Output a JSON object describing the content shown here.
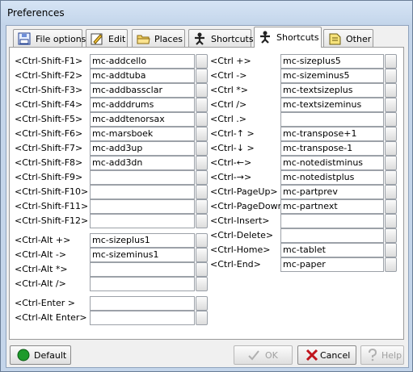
{
  "window": {
    "title": "Preferences"
  },
  "tabs": [
    {
      "label": "File options",
      "icon": "file-options-icon"
    },
    {
      "label": "Edit",
      "icon": "edit-icon"
    },
    {
      "label": "Places",
      "icon": "folder-icon"
    },
    {
      "label": "Shortcuts",
      "icon": "shortcuts-figure-icon"
    },
    {
      "label": "Shortcuts",
      "icon": "shortcuts-figure-icon",
      "active": true
    },
    {
      "label": "Other",
      "icon": "other-icon"
    }
  ],
  "left_shortcuts": [
    {
      "key": "<Ctrl-Shift-F1>",
      "value": "mc-addcello"
    },
    {
      "key": "<Ctrl-Shift-F2>",
      "value": "mc-addtuba"
    },
    {
      "key": "<Ctrl-Shift-F3>",
      "value": "mc-addbassclar"
    },
    {
      "key": "<Ctrl-Shift-F4>",
      "value": "mc-adddrums"
    },
    {
      "key": "<Ctrl-Shift-F5>",
      "value": "mc-addtenorsax"
    },
    {
      "key": "<Ctrl-Shift-F6>",
      "value": "mc-marsboek"
    },
    {
      "key": "<Ctrl-Shift-F7>",
      "value": "mc-add3up"
    },
    {
      "key": "<Ctrl-Shift-F8>",
      "value": "mc-add3dn"
    },
    {
      "key": "<Ctrl-Shift-F9>",
      "value": ""
    },
    {
      "key": "<Ctrl-Shift-F10>",
      "value": ""
    },
    {
      "key": "<Ctrl-Shift-F11>",
      "value": ""
    },
    {
      "key": "<Ctrl-Shift-F12>",
      "value": ""
    },
    {
      "key": "<Ctrl-Alt +>",
      "value": "mc-sizeplus1"
    },
    {
      "key": "<Ctrl-Alt ->",
      "value": "mc-sizeminus1"
    },
    {
      "key": "<Ctrl-Alt *>",
      "value": ""
    },
    {
      "key": "<Ctrl-Alt />",
      "value": ""
    },
    {
      "key": "<Ctrl-Enter >",
      "value": ""
    },
    {
      "key": "<Ctrl-Alt Enter>",
      "value": ""
    }
  ],
  "right_shortcuts": [
    {
      "key": "<Ctrl +>",
      "value": "mc-sizeplus5"
    },
    {
      "key": "<Ctrl ->",
      "value": "mc-sizeminus5"
    },
    {
      "key": "<Ctrl *>",
      "value": "mc-textsizeplus"
    },
    {
      "key": "<Ctrl />",
      "value": "mc-textsizeminus"
    },
    {
      "key": "<Ctrl .>",
      "value": ""
    },
    {
      "key": "<Ctrl-↑ >",
      "value": "mc-transpose+1"
    },
    {
      "key": "<Ctrl-↓ >",
      "value": "mc-transpose-1"
    },
    {
      "key": "<Ctrl-←>",
      "value": "mc-notedistminus"
    },
    {
      "key": "<Ctrl-→>",
      "value": "mc-notedistplus"
    },
    {
      "key": "<Ctrl-PageUp>",
      "value": "mc-partprev"
    },
    {
      "key": "<Ctrl-PageDown>",
      "value": "mc-partnext"
    },
    {
      "key": "<Ctrl-Insert>",
      "value": ""
    },
    {
      "key": "<Ctrl-Delete>",
      "value": ""
    },
    {
      "key": "<Ctrl-Home>",
      "value": "mc-tablet"
    },
    {
      "key": "<Ctrl-End>",
      "value": "mc-paper"
    }
  ],
  "buttons": {
    "default_label": "Default",
    "ok_label": "OK",
    "cancel_label": "Cancel",
    "help_label": "Help"
  },
  "colors": {
    "accent_green": "#1e9a2c",
    "cancel_red": "#c0141c"
  }
}
